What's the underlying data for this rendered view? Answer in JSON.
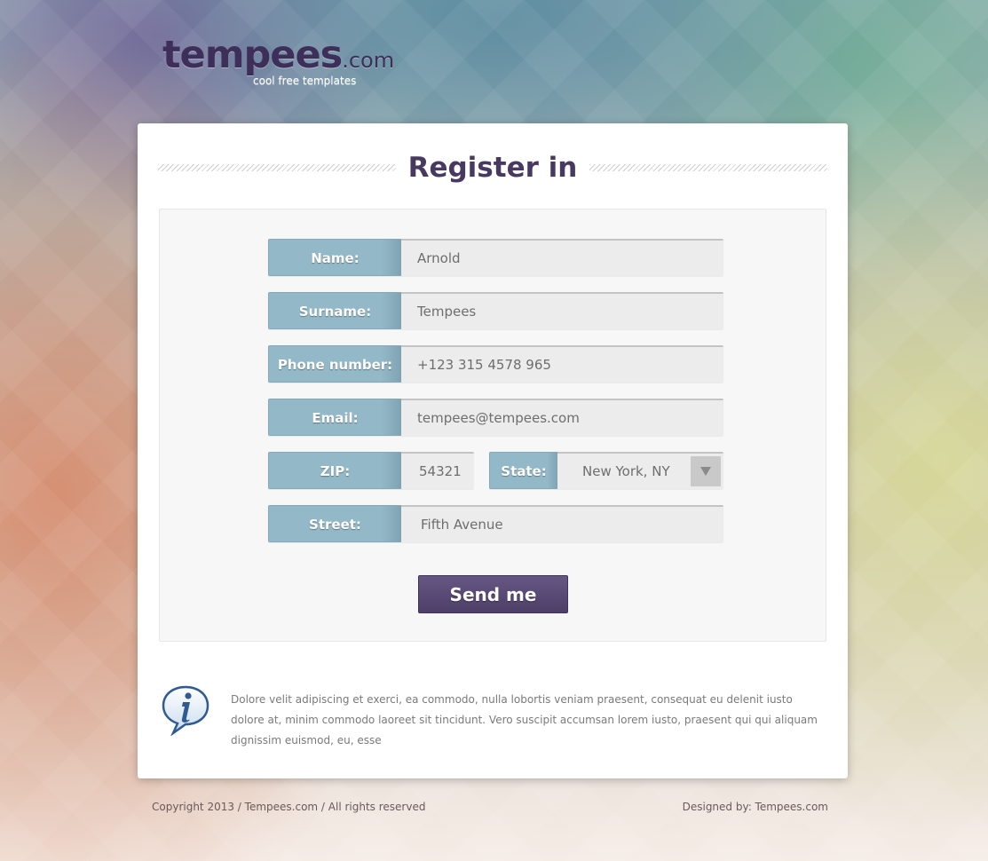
{
  "logo": {
    "name": "tempees",
    "suffix": ".com",
    "tagline": "cool free templates"
  },
  "form": {
    "title": "Register in",
    "fields": {
      "name": {
        "label": "Name:",
        "value": "Arnold"
      },
      "surname": {
        "label": "Surname:",
        "value": "Tempees"
      },
      "phone": {
        "label": "Phone number:",
        "value": "+123 315 4578 965"
      },
      "email": {
        "label": "Email:",
        "value": "tempees@tempees.com"
      },
      "zip": {
        "label": "ZIP:",
        "value": "54321"
      },
      "state": {
        "label": "State:",
        "value": "New York, NY"
      },
      "street": {
        "label": "Street:",
        "value": "Fifth Avenue"
      }
    },
    "submit_label": "Send me"
  },
  "info": {
    "icon": "info-icon",
    "text": "Dolore velit adipiscing et exerci, ea commodo, nulla lobortis veniam praesent, consequat eu delenit iusto dolore at, minim commodo laoreet sit tincidunt. Vero suscipit accumsan lorem iusto, praesent qui qui aliquam dignissim euismod, eu, esse"
  },
  "footer": {
    "copyright": "Copyright 2013 / Tempees.com / All rights reserved",
    "designed_by": "Designed by: Tempees.com"
  },
  "colors": {
    "accent": "#47395f",
    "label_bg": "#93b8c7",
    "button_bg": "#574871"
  }
}
